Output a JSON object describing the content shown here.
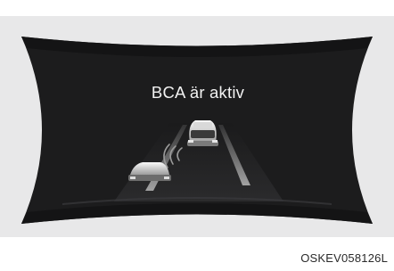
{
  "cluster_display": {
    "status_message": "BCA är aktiv",
    "warning_icon": "blind-spot-collision-avoidance-icon"
  },
  "image_code": "OSKEV058126L"
}
